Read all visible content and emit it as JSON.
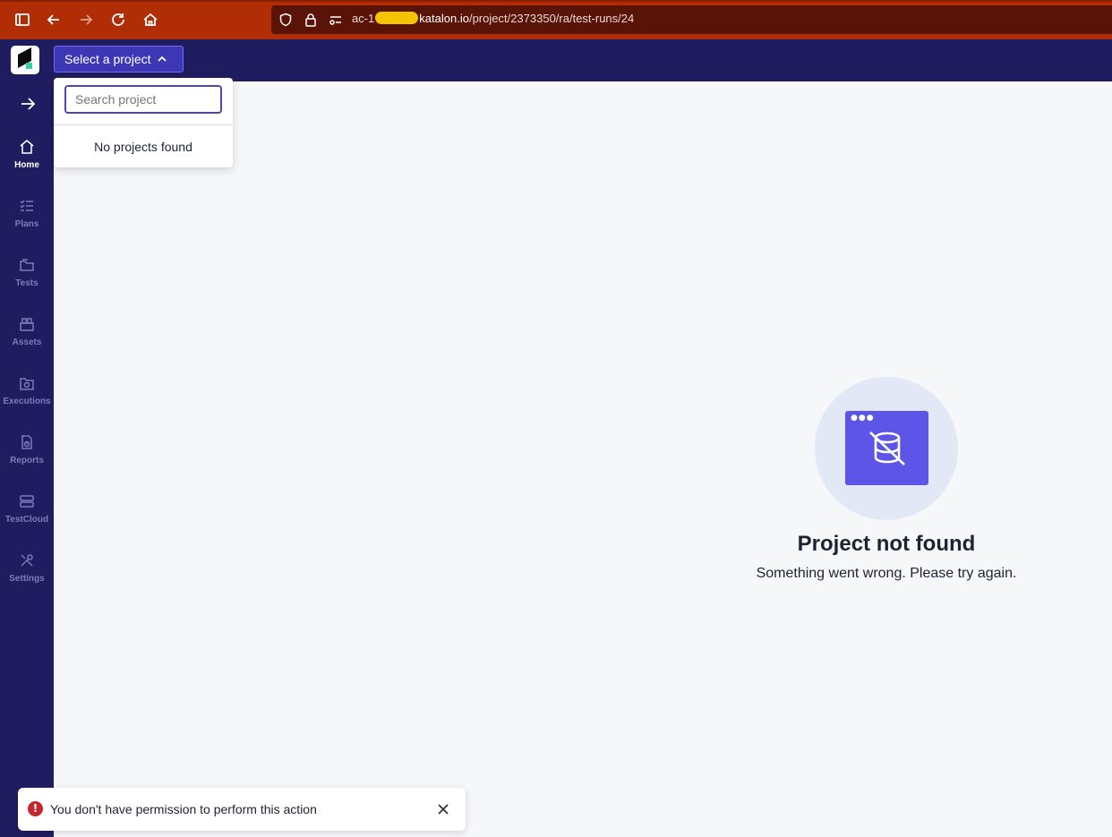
{
  "browser": {
    "url_prefix": "ac-1",
    "url_host": "katalon.io",
    "url_path": "/project/2373350/ra/test-runs/24"
  },
  "header": {
    "project_select_label": "Select a project"
  },
  "dropdown": {
    "search_placeholder": "Search project",
    "empty_text": "No projects found"
  },
  "sidebar": {
    "items": [
      {
        "label": "Home",
        "icon": "home-icon",
        "active": true
      },
      {
        "label": "Plans",
        "icon": "checklist-icon"
      },
      {
        "label": "Tests",
        "icon": "folder-icon"
      },
      {
        "label": "Assets",
        "icon": "assets-icon"
      },
      {
        "label": "Executions",
        "icon": "executions-icon"
      },
      {
        "label": "Reports",
        "icon": "report-icon"
      },
      {
        "label": "TestCloud",
        "icon": "server-icon"
      },
      {
        "label": "Settings",
        "icon": "tools-icon"
      }
    ]
  },
  "main": {
    "title": "Project not found",
    "subtitle": "Something went wrong. Please try again."
  },
  "toast": {
    "message": "You don't have permission to perform this action"
  },
  "colors": {
    "browser_bar": "#b02d05",
    "app_nav": "#201c60",
    "accent": "#5d54e8",
    "error": "#c4262e"
  }
}
